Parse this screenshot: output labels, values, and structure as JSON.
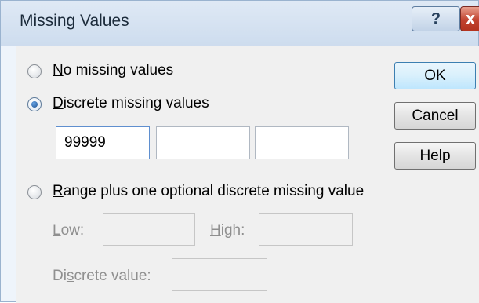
{
  "dialog": {
    "title": "Missing Values",
    "help_button": "?",
    "close_button": "x"
  },
  "options": {
    "no_missing": {
      "prefix": "",
      "mnemonic": "N",
      "suffix": "o missing values",
      "checked": false
    },
    "discrete": {
      "prefix": "",
      "mnemonic": "D",
      "suffix": "iscrete missing values",
      "checked": true
    },
    "range": {
      "prefix": "",
      "mnemonic": "R",
      "suffix": "ange plus one optional discrete missing value",
      "checked": false
    }
  },
  "discrete_values": [
    "99999",
    "",
    ""
  ],
  "range_fields": {
    "low_label_mnemonic": "L",
    "low_label_rest": "ow:",
    "low_value": "",
    "high_label_mnemonic": "H",
    "high_label_rest": "igh:",
    "high_value": "",
    "discrete_label_prefix": "Di",
    "discrete_label_mnemonic": "s",
    "discrete_label_rest": "crete value:",
    "discrete_value": ""
  },
  "buttons": {
    "ok": "OK",
    "cancel": "Cancel",
    "help": "Help"
  }
}
